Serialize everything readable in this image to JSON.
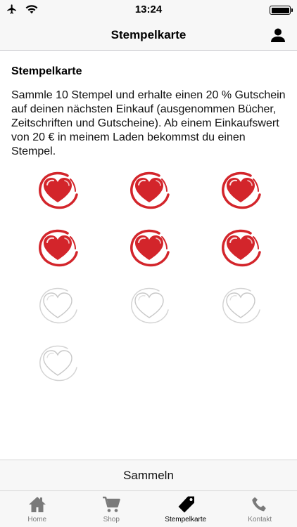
{
  "status_bar": {
    "time": "13:24"
  },
  "nav": {
    "title": "Stempelkarte"
  },
  "card": {
    "title": "Stempelkarte",
    "description": "Sammle 10 Stempel und erhalte einen 20 % Gutschein auf deinen nächsten Einkauf (ausgenommen Bücher, Zeitschriften und Gutscheine). Ab einem Einkaufswert von 20 € in meinem Laden bekommst du einen Stempel.",
    "stamps_total": 10,
    "stamps_collected": 6
  },
  "collect_button": {
    "label": "Sammeln"
  },
  "tabs": [
    {
      "label": "Home",
      "icon": "home-icon",
      "active": false
    },
    {
      "label": "Shop",
      "icon": "cart-icon",
      "active": false
    },
    {
      "label": "Stempelkarte",
      "icon": "tag-icon",
      "active": true
    },
    {
      "label": "Kontakt",
      "icon": "phone-icon",
      "active": false
    }
  ],
  "colors": {
    "heart": "#d3252b",
    "tab_active": "#000000",
    "tab_inactive": "#7a7a7a"
  }
}
